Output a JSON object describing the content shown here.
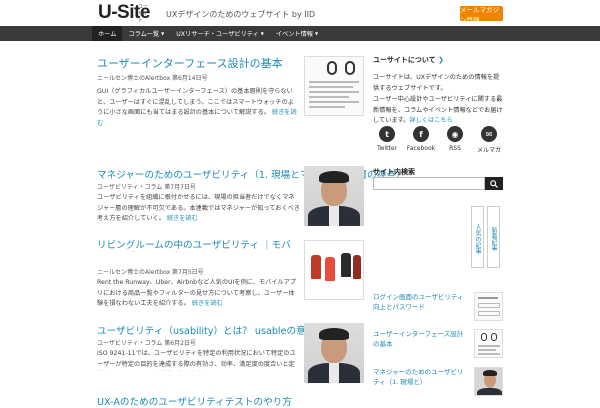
{
  "header": {
    "logo_text": "U-Site",
    "logo_ruby": "ユーサイト",
    "tagline": "UXデザインのためのウェブサイト by IID",
    "cta_label": "メールマガジン登録"
  },
  "nav": {
    "items": [
      {
        "label": "ホーム",
        "dropdown": false
      },
      {
        "label": "コラム一覧",
        "dropdown": true
      },
      {
        "label": "UXリサーチ・ユーザビリティ",
        "dropdown": true
      },
      {
        "label": "イベント情報",
        "dropdown": true
      }
    ]
  },
  "feature": {
    "title": "ユーザーインターフェース設計の基本",
    "meta": "ニールセン博士のAlertbox 第6月14日号",
    "excerpt_pre": "GUI（グラフィカルユーザーインターフェース）の基本原則を守らないと、ユーザーはすぐに混乱してしまう。ここではスマートウォッチのように小さな画面にも当てはまる設計の基本について解説する。 ",
    "more": "続きを読む"
  },
  "articles": [
    {
      "title": "マネジャーのためのユーザビリティ（1. 現場とマネジメント層の視点）",
      "meta": "ユーザビリティ・コラム 第7月7日号",
      "excerpt": "ユーザビリティを組織に根付かせるには、現場の担当者だけでなくマネジャー層の理解が不可欠である。本連載ではマネジャーが知っておくべき考え方を紹介していく。",
      "more": "続きを読む"
    },
    {
      "title": "リビングルームの中のユーザビリティ ｜モバイルアプリ3つの落とし穴を避けるために",
      "meta": "ニールセン博士のAlertbox 第7月5日号",
      "excerpt": "Rent the Runway、Uber、Airbnbなど人気のUIを例に、モバイルアプリにおける商品一覧やフィルターの見せ方について考察し、ユーザー体験を損なわない工夫を紹介する。 ",
      "more": "続きを読む"
    },
    {
      "title": "ユーザビリティ（usability）とは？ usableの意味と定義",
      "meta": "ユーザビリティ・コラム 第6月2日号",
      "excerpt": "ISO 9241-11では、ユーザビリティを特定の利用状況において特定のユーザーが特定の目的を達成する際の有効さ、効率、満足度の度合いと定義している。usable（使える）とは何か",
      "more": "続きを読む"
    },
    {
      "title": "UX-Aのためのユーザビリティテストのやり方"
    }
  ],
  "sidebar": {
    "about_head": "ユーサイトについて",
    "about_text_1": "ユーサイトは、UXデザインのための情報を提供するウェブサイトです。",
    "about_text_2": "ユーザー中心設計やユーザビリティに関する最新情報を、コラムやイベント情報などでお届けしています。",
    "about_more": "詳しくはこちら",
    "follow": [
      {
        "label": "Twitter",
        "icon": "twitter-icon",
        "glyph": "t"
      },
      {
        "label": "Facebook",
        "icon": "facebook-icon",
        "glyph": "f"
      },
      {
        "label": "RSS",
        "icon": "rss-icon",
        "glyph": "◉"
      },
      {
        "label": "メルマガ",
        "icon": "mail-icon",
        "glyph": "✉"
      }
    ],
    "search_head": "サイト内検索",
    "search_placeholder": "",
    "vtabs": [
      "人気の記事",
      "新着記事"
    ],
    "list": [
      {
        "title": "ログイン画面のユーザビリティ向上とパスワード"
      },
      {
        "title": "ユーザーインターフェース設計の基本"
      },
      {
        "title": "マネジャーのためのユーザビリティ（1. 現場と）"
      }
    ]
  },
  "colors": {
    "accent": "#1a8ab5",
    "brand_orange": "#f08300",
    "nav_bg": "#3a3a3a"
  }
}
